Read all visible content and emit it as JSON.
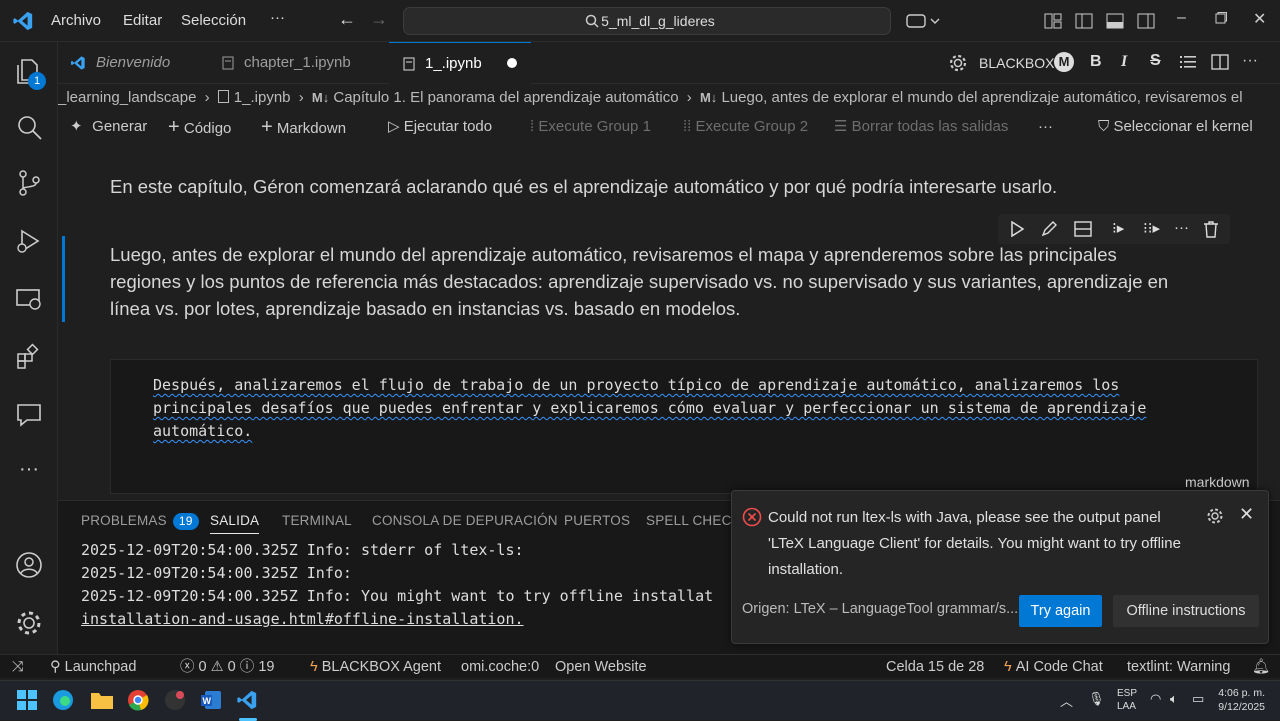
{
  "titlebar": {
    "menu": [
      "Archivo",
      "Editar",
      "Selección"
    ],
    "search": "5_ml_dl_g_lideres"
  },
  "tabs": [
    {
      "label": "Bienvenido"
    },
    {
      "label": "chapter_1.ipynb"
    },
    {
      "label": "1_.ipynb"
    }
  ],
  "tabbar_right": {
    "blackbox": "BLACKBOX"
  },
  "breadcrumb": {
    "parts": [
      "_learning_landscape",
      "1_.ipynb",
      "Capítulo 1. El panorama del aprendizaje automático",
      "Luego, antes de explorar el mundo del aprendizaje automático, revisaremos el"
    ]
  },
  "toolbar": {
    "generate": "Generar",
    "code": "Código",
    "markdown": "Markdown",
    "run_all": "Ejecutar todo",
    "group1": "Execute Group 1",
    "group2": "Execute Group 2",
    "clear": "Borrar todas las salidas",
    "kernel": "Seleccionar el kernel"
  },
  "notebook": {
    "cell1": "En este capítulo, Géron comenzará aclarando qué es el aprendizaje automático y por qué podría interesarte usarlo.",
    "cell2_lines": [
      "Luego, antes de explorar el mundo del aprendizaje automático, revisaremos el mapa y aprenderemos sobre las principales",
      "regiones y los puntos de referencia más destacados: aprendizaje supervisado vs. no supervisado y sus variantes, aprendizaje en",
      "línea vs. por lotes, aprendizaje basado en instancias vs. basado en modelos."
    ],
    "editor_lines": [
      "Después, analizaremos el flujo de trabajo de un proyecto típico de aprendizaje automático, analizaremos los",
      "principales desafíos que puedes enfrentar y explicaremos cómo evaluar y perfeccionar un sistema de aprendizaje",
      "automático."
    ],
    "cell_language": "markdown"
  },
  "panel": {
    "tabs": [
      "PROBLEMAS",
      "SALIDA",
      "TERMINAL",
      "CONSOLA DE DEPURACIÓN",
      "PUERTOS",
      "SPELL CHECKE"
    ],
    "problems_count": "19",
    "log": [
      "2025-12-09T20:54:00.325Z Info: stderr of ltex-ls:",
      "2025-12-09T20:54:00.325Z Info:",
      "2025-12-09T20:54:00.325Z Info: You might want to try offline installat",
      "installation-and-usage.html#offline-installation."
    ]
  },
  "notification": {
    "message": "Could not run ltex-ls with Java, please see the output panel 'LTeX Language Client' for details. You might want to try offline installation.",
    "source": "Origen: LTeX – LanguageTool grammar/s...",
    "try_again": "Try again",
    "offline": "Offline instructions"
  },
  "statusbar": {
    "launchpad": "Launchpad",
    "errors": "0",
    "warnings": "0",
    "infos": "19",
    "agent": "BLACKBOX Agent",
    "omi": "omi.coche:0",
    "open_website": "Open Website",
    "cell": "Celda 15 de 28",
    "ai_chat": "AI Code Chat",
    "textlint": "textlint: Warning"
  },
  "taskbar": {
    "lang1": "ESP",
    "lang2": "LAA",
    "time": "4:06 p. m.",
    "date": "9/12/2025"
  },
  "activity": {
    "explorer_badge": "1"
  },
  "colors": {
    "accent": "#0078d4",
    "error": "#f14c4c"
  }
}
